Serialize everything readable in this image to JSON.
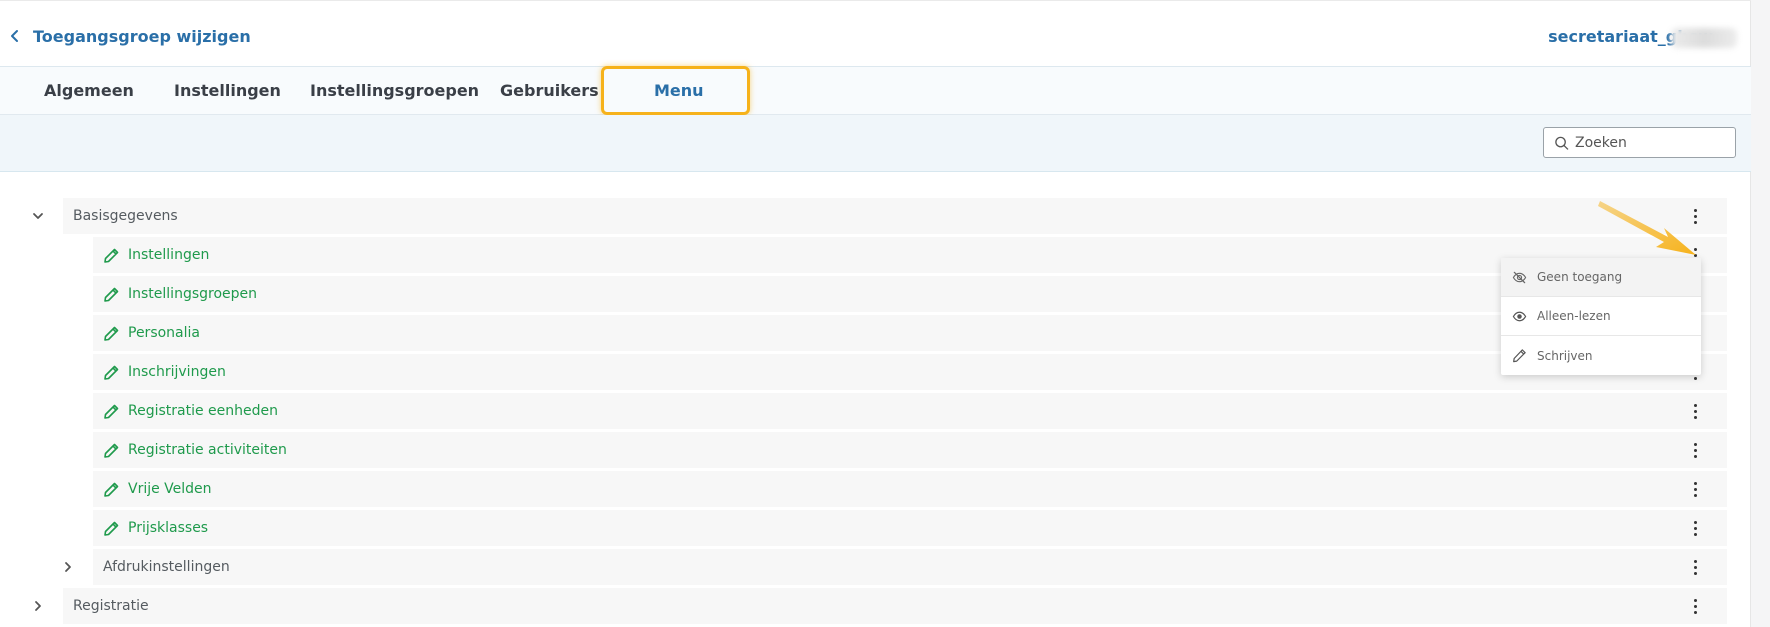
{
  "header": {
    "title": "Toegangsgroep wijzigen",
    "user": "secretariaat_gbsw"
  },
  "tabs": [
    {
      "label": "Algemeen"
    },
    {
      "label": "Instellingen"
    },
    {
      "label": "Instellingsgroepen"
    },
    {
      "label": "Gebruikers"
    },
    {
      "label": "Menu",
      "active": true
    }
  ],
  "search": {
    "placeholder": "Zoeken"
  },
  "tree": {
    "group1": "Basisgegevens",
    "items": [
      {
        "label": "Instellingen",
        "icon": "pencil-icon"
      },
      {
        "label": "Instellingsgroepen",
        "icon": "pencil-icon"
      },
      {
        "label": "Personalia",
        "icon": "pencil-icon"
      },
      {
        "label": "Inschrijvingen",
        "icon": "pencil-icon"
      },
      {
        "label": "Registratie eenheden",
        "icon": "pencil-icon"
      },
      {
        "label": "Registratie activiteiten",
        "icon": "pencil-icon"
      },
      {
        "label": "Vrije Velden",
        "icon": "pencil-icon"
      },
      {
        "label": "Prijsklasses",
        "icon": "pencil-icon"
      }
    ],
    "subgroup": "Afdrukinstellingen",
    "group2": "Registratie"
  },
  "permission_menu": [
    {
      "label": "Geen toegang",
      "icon": "eye-off-icon"
    },
    {
      "label": "Alleen-lezen",
      "icon": "eye-icon"
    },
    {
      "label": "Schrijven",
      "icon": "pencil-icon"
    }
  ],
  "colors": {
    "accent": "#2a6fa8",
    "item_green": "#1f9a4c",
    "highlight": "#f6b21b"
  }
}
